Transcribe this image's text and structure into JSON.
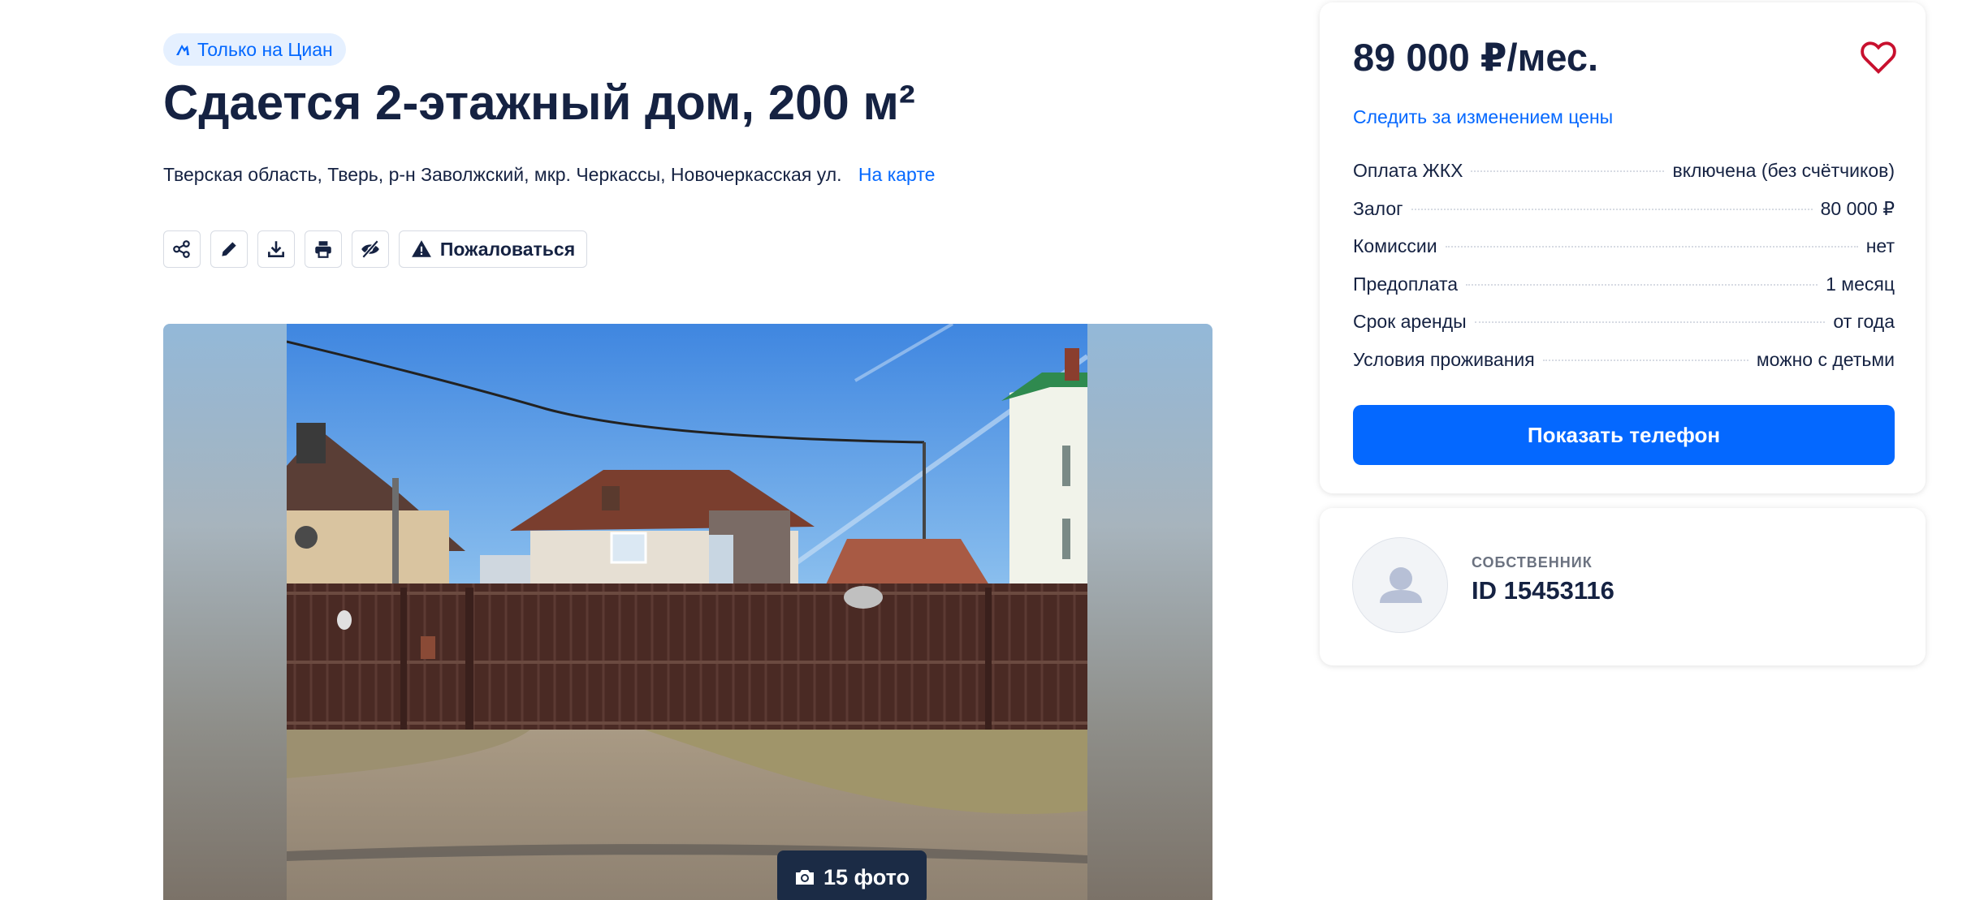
{
  "badge": {
    "label": "Только на Циан"
  },
  "listing": {
    "title": "Сдается 2-этажный дом, 200 м²",
    "address": "Тверская область, Тверь, р-н Заволжский, мкр. Черкассы, Новочеркасская ул.",
    "map_link": "На карте"
  },
  "toolbar": {
    "icons": [
      "share-icon",
      "edit-icon",
      "download-icon",
      "print-icon",
      "hide-icon"
    ],
    "complain_label": "Пожаловаться"
  },
  "gallery": {
    "photo_count_label": "15 фото"
  },
  "price_card": {
    "price": "89 000 ₽/мес.",
    "track_price": "Следить за изменением цены",
    "terms": [
      {
        "label": "Оплата ЖКХ",
        "value": "включена (без счётчиков)"
      },
      {
        "label": "Залог",
        "value": "80 000 ₽"
      },
      {
        "label": "Комиссии",
        "value": "нет"
      },
      {
        "label": "Предоплата",
        "value": "1 месяц"
      },
      {
        "label": "Срок аренды",
        "value": "от года"
      },
      {
        "label": "Условия проживания",
        "value": "можно с детьми"
      }
    ],
    "show_phone": "Показать телефон"
  },
  "owner": {
    "role": "СОБСТВЕННИК",
    "id": "ID 15453116"
  },
  "colors": {
    "accent": "#0468ff",
    "text": "#152242",
    "heart": "#c8102e",
    "badge_bg": "#e5f0ff"
  }
}
